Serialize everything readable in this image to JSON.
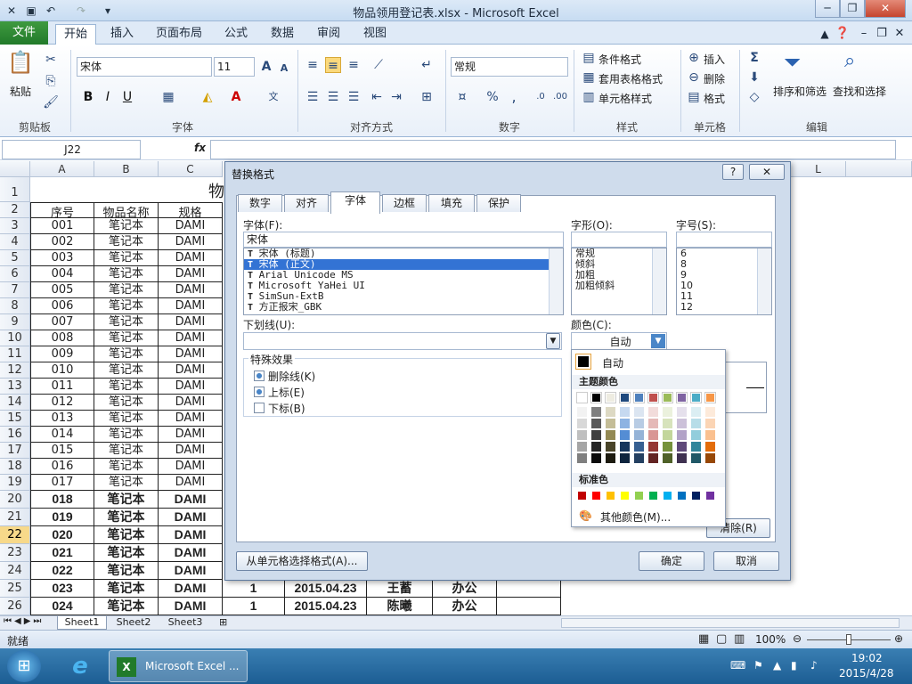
{
  "window": {
    "title": "物品领用登记表.xlsx - Microsoft Excel"
  },
  "tabs": [
    "文件",
    "开始",
    "插入",
    "页面布局",
    "公式",
    "数据",
    "审阅",
    "视图"
  ],
  "ribbon": {
    "clipboard": {
      "paste": "粘贴",
      "label": "剪贴板"
    },
    "font": {
      "name": "宋体",
      "size": "11",
      "label": "字体"
    },
    "alignment": {
      "label": "对齐方式"
    },
    "number": {
      "format": "常规",
      "label": "数字"
    },
    "styles": {
      "conditional": "条件格式",
      "table": "套用表格格式",
      "cell": "单元格样式",
      "label": "样式"
    },
    "cells": {
      "insert": "插入",
      "delete": "删除",
      "format": "格式",
      "label": "单元格"
    },
    "editing": {
      "sort": "排序和筛选",
      "find": "查找和选择",
      "label": "编辑"
    }
  },
  "formula_bar": {
    "name_box": "J22",
    "fx": "fx"
  },
  "columns": [
    "A",
    "B",
    "C",
    "L"
  ],
  "sheet": {
    "title_partial": "物",
    "headers": [
      "序号",
      "物品名称",
      "规格"
    ],
    "rows": [
      {
        "n": "3",
        "a": "001",
        "b": "笔记本",
        "c": "DAMI"
      },
      {
        "n": "4",
        "a": "002",
        "b": "笔记本",
        "c": "DAMI"
      },
      {
        "n": "5",
        "a": "003",
        "b": "笔记本",
        "c": "DAMI"
      },
      {
        "n": "6",
        "a": "004",
        "b": "笔记本",
        "c": "DAMI"
      },
      {
        "n": "7",
        "a": "005",
        "b": "笔记本",
        "c": "DAMI"
      },
      {
        "n": "8",
        "a": "006",
        "b": "笔记本",
        "c": "DAMI"
      },
      {
        "n": "9",
        "a": "007",
        "b": "笔记本",
        "c": "DAMI"
      },
      {
        "n": "10",
        "a": "008",
        "b": "笔记本",
        "c": "DAMI"
      },
      {
        "n": "11",
        "a": "009",
        "b": "笔记本",
        "c": "DAMI"
      },
      {
        "n": "12",
        "a": "010",
        "b": "笔记本",
        "c": "DAMI"
      },
      {
        "n": "13",
        "a": "011",
        "b": "笔记本",
        "c": "DAMI"
      },
      {
        "n": "14",
        "a": "012",
        "b": "笔记本",
        "c": "DAMI"
      },
      {
        "n": "15",
        "a": "013",
        "b": "笔记本",
        "c": "DAMI"
      },
      {
        "n": "16",
        "a": "014",
        "b": "笔记本",
        "c": "DAMI"
      },
      {
        "n": "17",
        "a": "015",
        "b": "笔记本",
        "c": "DAMI"
      },
      {
        "n": "18",
        "a": "016",
        "b": "笔记本",
        "c": "DAMI"
      },
      {
        "n": "19",
        "a": "017",
        "b": "笔记本",
        "c": "DAMI"
      }
    ],
    "bold_rows": [
      {
        "n": "20",
        "a": "018",
        "b": "笔记本",
        "c": "DAMI"
      },
      {
        "n": "21",
        "a": "019",
        "b": "笔记本",
        "c": "DAMI"
      },
      {
        "n": "22",
        "a": "020",
        "b": "笔记本",
        "c": "DAMI"
      },
      {
        "n": "23",
        "a": "021",
        "b": "笔记本",
        "c": "DAMI"
      },
      {
        "n": "24",
        "a": "022",
        "b": "笔记本",
        "c": "DAMI"
      },
      {
        "n": "25",
        "a": "023",
        "b": "笔记本",
        "c": "DAMI",
        "d": "1",
        "e": "2015.04.23",
        "f": "王蓄",
        "g": "办公"
      },
      {
        "n": "26",
        "a": "024",
        "b": "笔记本",
        "c": "DAMI",
        "d": "1",
        "e": "2015.04.23",
        "f": "陈曦",
        "g": "办公"
      }
    ]
  },
  "sheets": [
    "Sheet1",
    "Sheet2",
    "Sheet3"
  ],
  "status": {
    "mode": "就绪",
    "zoom": "100%"
  },
  "taskbar": {
    "app": "Microsoft Excel ...",
    "time": "19:02",
    "date": "2015/4/28"
  },
  "dialog": {
    "title": "替换格式",
    "tabs": [
      "数字",
      "对齐",
      "字体",
      "边框",
      "填充",
      "保护"
    ],
    "font_label": "字体(F):",
    "font_value": "宋体",
    "font_list": [
      "宋体 (标题)",
      "宋体 (正文)",
      "Arial Unicode MS",
      "Microsoft YaHei UI",
      "SimSun-ExtB",
      "方正报宋_GBK"
    ],
    "style_label": "字形(O):",
    "style_list": [
      "常规",
      "倾斜",
      "加粗",
      "加粗倾斜"
    ],
    "size_label": "字号(S):",
    "size_list": [
      "6",
      "8",
      "9",
      "10",
      "11",
      "12"
    ],
    "underline_label": "下划线(U):",
    "color_label": "颜色(C):",
    "color_value": "自动",
    "effects_label": "特殊效果",
    "effects": [
      "删除线(K)",
      "上标(E)",
      "下标(B)"
    ],
    "clear": "清除(R)",
    "from_cell": "从单元格选择格式(A)...",
    "ok": "确定",
    "cancel": "取消"
  },
  "palette": {
    "auto": "自动",
    "theme_label": "主题颜色",
    "std_label": "标准色",
    "more": "其他颜色(M)...",
    "theme_top": [
      "#ffffff",
      "#000000",
      "#eeece1",
      "#1f497d",
      "#4f81bd",
      "#c0504d",
      "#9bbb59",
      "#8064a2",
      "#4bacc6",
      "#f79646"
    ],
    "theme_shades": [
      [
        "#f2f2f2",
        "#7f7f7f",
        "#ddd9c3",
        "#c6d9f0",
        "#dbe5f1",
        "#f2dcdb",
        "#ebf1dd",
        "#e5e0ec",
        "#dbeef3",
        "#fdeada"
      ],
      [
        "#d8d8d8",
        "#595959",
        "#c4bd97",
        "#8db3e2",
        "#b8cce4",
        "#e5b9b7",
        "#d7e3bc",
        "#ccc1d9",
        "#b7dde8",
        "#fbd5b5"
      ],
      [
        "#bfbfbf",
        "#3f3f3f",
        "#938953",
        "#548dd4",
        "#95b3d7",
        "#d99694",
        "#c3d69b",
        "#b2a2c7",
        "#92cddc",
        "#fac08f"
      ],
      [
        "#a5a5a5",
        "#262626",
        "#494429",
        "#17365d",
        "#366092",
        "#953734",
        "#76923c",
        "#5f497a",
        "#31859b",
        "#e36c09"
      ],
      [
        "#7f7f7f",
        "#0c0c0c",
        "#1d1b10",
        "#0f243e",
        "#244061",
        "#632423",
        "#4f6128",
        "#3f3151",
        "#205867",
        "#974806"
      ]
    ],
    "standard": [
      "#c00000",
      "#ff0000",
      "#ffc000",
      "#ffff00",
      "#92d050",
      "#00b050",
      "#00b0f0",
      "#0070c0",
      "#002060",
      "#7030a0"
    ]
  }
}
